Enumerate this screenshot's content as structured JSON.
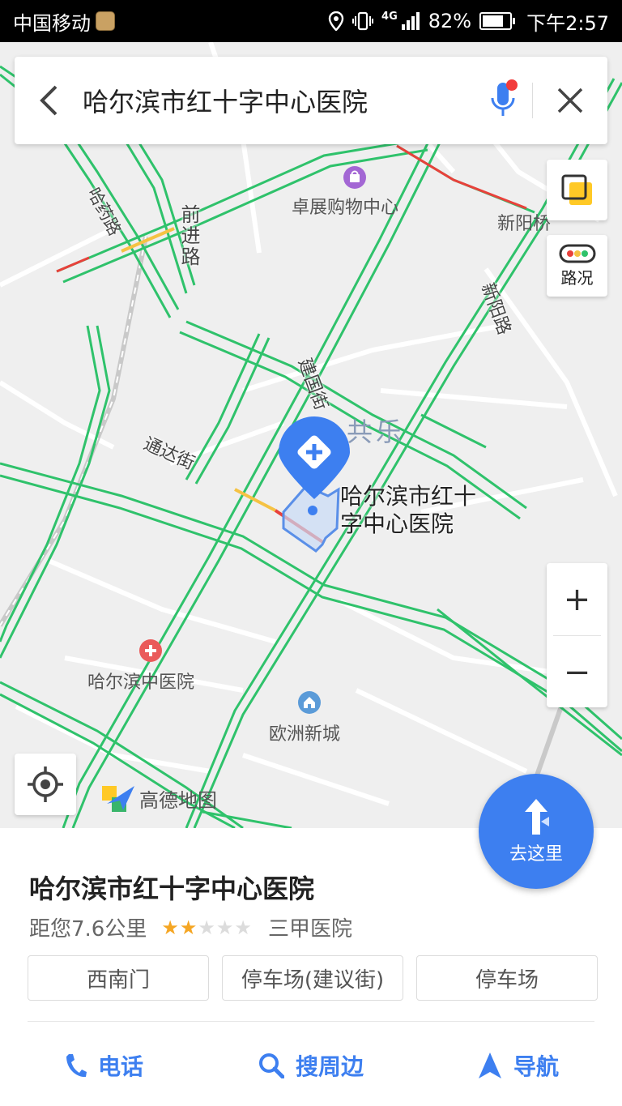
{
  "status_bar": {
    "carrier": "中国移动",
    "network": "4G",
    "battery": "82%",
    "battery_level": 0.82,
    "time": "下午2:57"
  },
  "search": {
    "query": "哈尔滨市红十字中心医院"
  },
  "map_controls": {
    "traffic_label": "路况",
    "zoom_in": "+",
    "zoom_out": "−"
  },
  "map": {
    "pois": {
      "mall": "卓展购物中心",
      "xinyang_bridge": "新阳桥",
      "district": "共乐",
      "tcm_hospital": "哈尔滨中医院",
      "ouzhou": "欧洲新城"
    },
    "roads": {
      "hayao": "哈药路",
      "qianjin": "前进路",
      "xinyang": "新阳路",
      "jianguo": "建国街",
      "tongda": "通达街"
    },
    "marker_label_line1": "哈尔滨市红十",
    "marker_label_line2": "字中心医院",
    "logo_text": "高德地图",
    "colors": {
      "road_green": "#2fc26b",
      "road_yellow": "#f5c243",
      "road_red": "#e8413b",
      "accent_blue": "#3d7ff0"
    }
  },
  "goto_button": {
    "label": "去这里"
  },
  "place": {
    "name": "哈尔滨市红十字中心医院",
    "distance": "距您7.6公里",
    "rating": 2,
    "rating_max": 5,
    "grade": "三甲医院",
    "entrances": [
      "西南门",
      "停车场(建议街)",
      "停车场"
    ]
  },
  "actions": [
    {
      "label": "电话",
      "icon": "phone-icon"
    },
    {
      "label": "搜周边",
      "icon": "search-icon"
    },
    {
      "label": "导航",
      "icon": "navigation-icon"
    }
  ]
}
